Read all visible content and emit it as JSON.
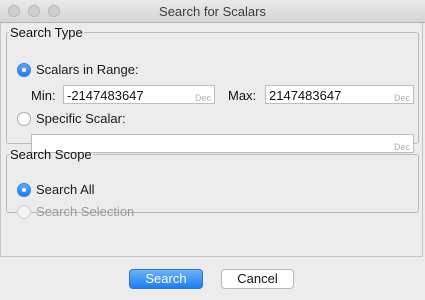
{
  "window": {
    "title": "Search for Scalars"
  },
  "search_type": {
    "legend": "Search Type",
    "range_radio": "Scalars in Range:",
    "min_label": "Min:",
    "min_value": "-2147483647",
    "min_format": "Dec",
    "max_label": "Max:",
    "max_value": "2147483647",
    "max_format": "Dec",
    "specific_radio": "Specific Scalar:",
    "specific_value": "",
    "specific_format": "Dec"
  },
  "search_scope": {
    "legend": "Search Scope",
    "all_radio": "Search All",
    "selection_radio": "Search Selection"
  },
  "buttons": {
    "search": "Search",
    "cancel": "Cancel"
  }
}
